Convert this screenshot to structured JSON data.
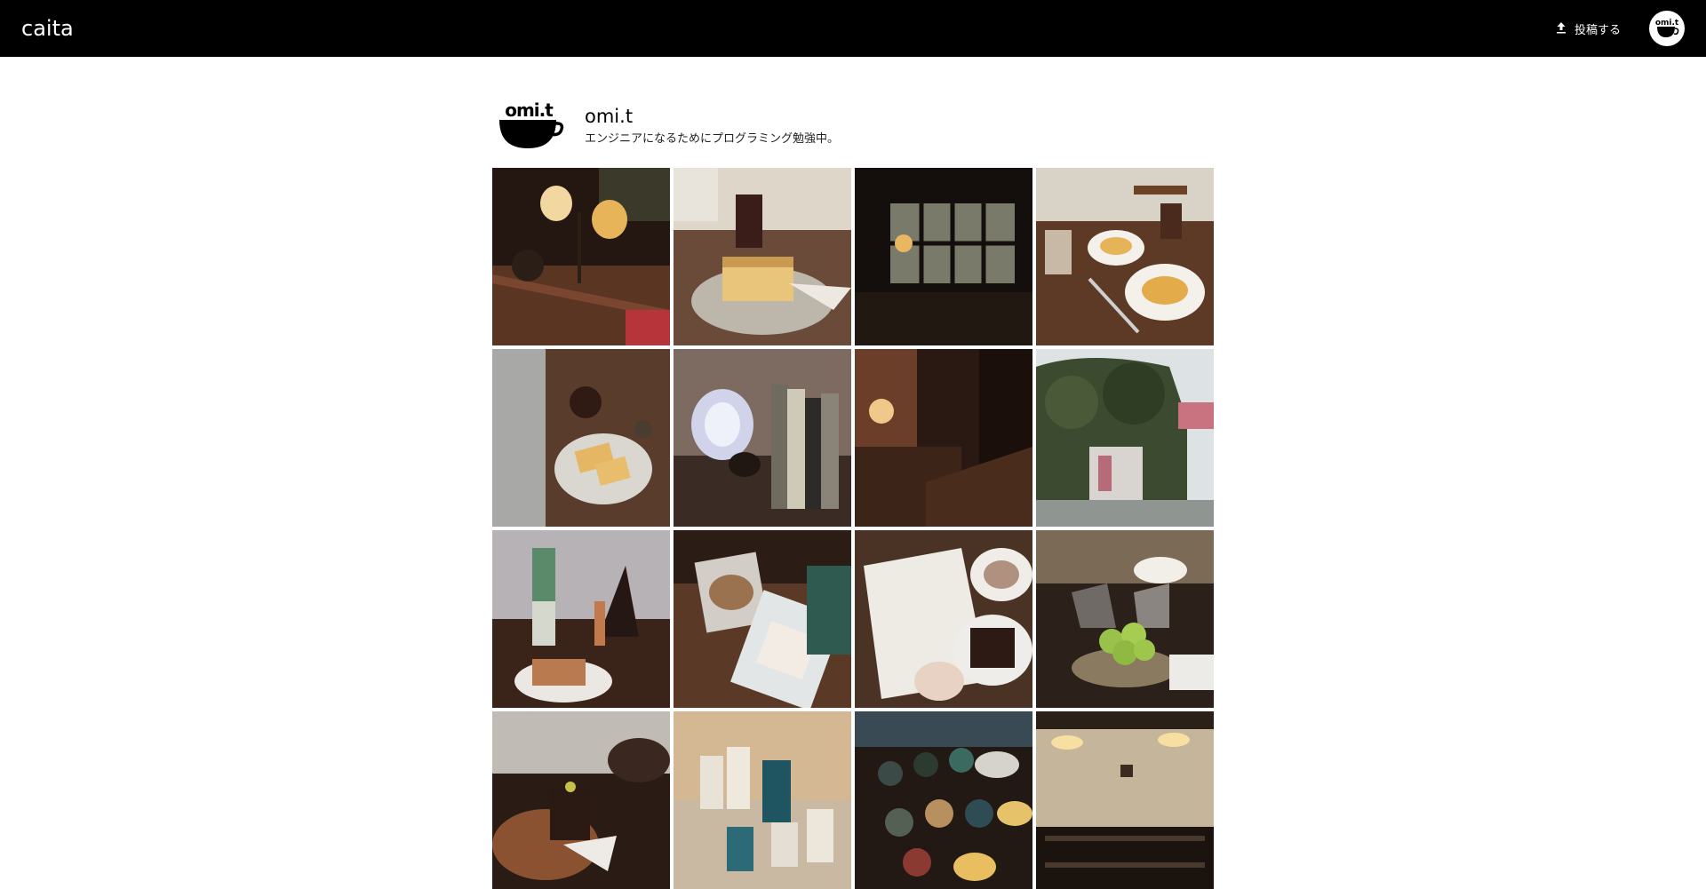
{
  "app": {
    "brand": "caita",
    "upload_label": "投稿する"
  },
  "profile": {
    "name": "omi.t",
    "bio": "エンジニアになるためにプログラミング勉強中。",
    "avatar_logo_text": "omi.t"
  },
  "photos": [
    {
      "icon": "cafe-lamp-table-photo"
    },
    {
      "icon": "toast-and-iced-coffee-photo"
    },
    {
      "icon": "cafe-window-interior-photo"
    },
    {
      "icon": "crepes-and-drinks-photo"
    },
    {
      "icon": "toast-plate-photo"
    },
    {
      "icon": "lamp-and-books-photo"
    },
    {
      "icon": "dim-corridor-lamp-photo"
    },
    {
      "icon": "ivy-covered-building-photo"
    },
    {
      "icon": "matcha-drink-and-cake-photo"
    },
    {
      "icon": "cookie-and-card-photo"
    },
    {
      "icon": "coffee-cup-and-chocolate-photo"
    },
    {
      "icon": "melon-tart-photo"
    },
    {
      "icon": "canele-dessert-photo"
    },
    {
      "icon": "glassware-photo"
    },
    {
      "icon": "ceramic-cups-photo"
    },
    {
      "icon": "cafe-counter-lights-photo"
    }
  ],
  "colors": {
    "appbar": "#000000",
    "background": "#ffffff"
  }
}
